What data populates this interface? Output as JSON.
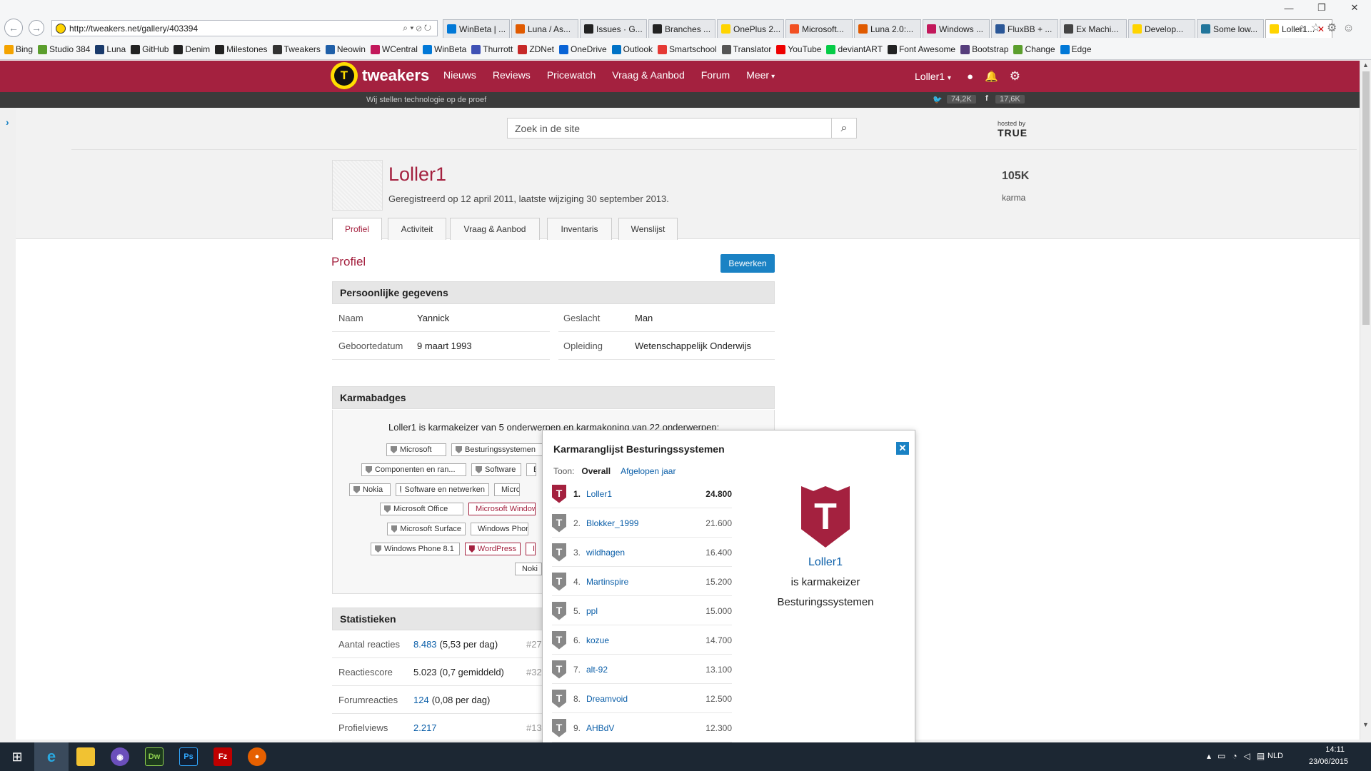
{
  "browser": {
    "url": "http://tweakers.net/gallery/403394",
    "tabs": [
      {
        "label": "WinBeta | ...",
        "icon": "winbeta-icon"
      },
      {
        "label": "Luna / As...",
        "icon": "luna-icon"
      },
      {
        "label": "Issues · G...",
        "icon": "github-icon"
      },
      {
        "label": "Branches ...",
        "icon": "github-icon"
      },
      {
        "label": "OnePlus 2...",
        "icon": "tweakers-icon"
      },
      {
        "label": "Microsoft...",
        "icon": "microsoft-icon"
      },
      {
        "label": "Luna 2.0:...",
        "icon": "luna-icon"
      },
      {
        "label": "Windows ...",
        "icon": "windows-icon"
      },
      {
        "label": "FluxBB + ...",
        "icon": "fluxbb-icon"
      },
      {
        "label": "Ex Machi...",
        "icon": "wikipedia-icon"
      },
      {
        "label": "Develop...",
        "icon": "tweakers-icon"
      },
      {
        "label": "Some low...",
        "icon": "wordpress-icon"
      },
      {
        "label": "Loller1...",
        "icon": "tweakers-icon"
      }
    ],
    "favorites": [
      "Bing",
      "Studio 384",
      "Luna",
      "GitHub",
      "Denim",
      "Milestones",
      "Tweakers",
      "Neowin",
      "WCentral",
      "WinBeta",
      "Thurrott",
      "ZDNet",
      "OneDrive",
      "Outlook",
      "Smartschool",
      "Translator",
      "YouTube",
      "deviantART",
      "Font Awesome",
      "Bootstrap",
      "Change",
      "Edge"
    ]
  },
  "site": {
    "logo_text": "tweakers",
    "tagline": "Wij stellen technologie op de proef",
    "nav": [
      "Nieuws",
      "Reviews",
      "Pricewatch",
      "Vraag & Aanbod",
      "Forum",
      "Meer"
    ],
    "user": "Loller1",
    "twitter_count": "74,2K",
    "facebook_count": "17,6K",
    "search_placeholder": "Zoek in de site",
    "hosted_by": "hosted by",
    "host": "TRUE"
  },
  "profile": {
    "name": "Loller1",
    "registered": "Geregistreerd op 12 april 2011, laatste wijziging 30 september 2013.",
    "karma_value": "105K",
    "karma_label": "karma",
    "tabs": [
      "Profiel",
      "Activiteit",
      "Vraag & Aanbod",
      "Inventaris",
      "Wenslijst"
    ],
    "section_title": "Profiel",
    "edit_label": "Bewerken",
    "personal_title": "Persoonlijke gegevens",
    "personal": [
      {
        "label": "Naam",
        "value": "Yannick"
      },
      {
        "label": "Geslacht",
        "value": "Man"
      },
      {
        "label": "Geboortedatum",
        "value": "9 maart 1993"
      },
      {
        "label": "Opleiding",
        "value": "Wetenschappelijk Onderwijs"
      }
    ],
    "karmabadges_title": "Karmabadges",
    "karmabadges_intro": "Loller1 is karmakeizer van 5 onderwerpen en karmakoning van 22 onderwerpen:",
    "badges": [
      [
        "Microsoft",
        "Besturingssystemen",
        "B"
      ],
      [
        "Componenten en ran...",
        "Software",
        "B"
      ],
      [
        "Nokia",
        "Software en netwerken",
        "Microsof"
      ],
      [
        "Microsoft Office",
        "Microsoft Windows 8"
      ],
      [
        "Microsoft Surface",
        "Windows Phone"
      ],
      [
        "Windows Phone 8.1",
        "WordPress",
        "I"
      ],
      [
        "Noki"
      ]
    ],
    "stats_title": "Statistieken",
    "stats": [
      {
        "label": "Aantal reacties",
        "value": "8.483",
        "extra": "(5,53 per dag)",
        "rank": "#27"
      },
      {
        "label": "Reactiescore",
        "value": "5.023",
        "extra": "(0,7 gemiddeld)",
        "rank": "#32"
      },
      {
        "label": "Forumreacties",
        "value": "124",
        "extra": "(0,08 per dag)",
        "rank": ""
      },
      {
        "label": "Profielviews",
        "value": "2.217",
        "extra": "",
        "rank": "#1325"
      }
    ]
  },
  "popup": {
    "title": "Karmaranglijst Besturingssystemen",
    "toon_label": "Toon:",
    "filter_active": "Overall",
    "filter_other": "Afgelopen jaar",
    "ranking": [
      {
        "rank": "1.",
        "name": "Loller1",
        "score": "24.800"
      },
      {
        "rank": "2.",
        "name": "Blokker_1999",
        "score": "21.600"
      },
      {
        "rank": "3.",
        "name": "wildhagen",
        "score": "16.400"
      },
      {
        "rank": "4.",
        "name": "Martinspire",
        "score": "15.200"
      },
      {
        "rank": "5.",
        "name": "ppl",
        "score": "15.000"
      },
      {
        "rank": "6.",
        "name": "kozue",
        "score": "14.700"
      },
      {
        "rank": "7.",
        "name": "alt-92",
        "score": "13.100"
      },
      {
        "rank": "8.",
        "name": "Dreamvoid",
        "score": "12.500"
      },
      {
        "rank": "9.",
        "name": "AHBdV",
        "score": "12.300"
      }
    ],
    "highlight_name": "Loller1",
    "highlight_line1": "is karmakeizer",
    "highlight_line2": "Besturingssystemen"
  },
  "taskbar": {
    "lang": "NLD",
    "time": "14:11",
    "date": "23/06/2015"
  },
  "colors": {
    "brand": "#a4213f",
    "link": "#0a5ea8",
    "button": "#1a82c4",
    "logo": "#ffdd00"
  }
}
